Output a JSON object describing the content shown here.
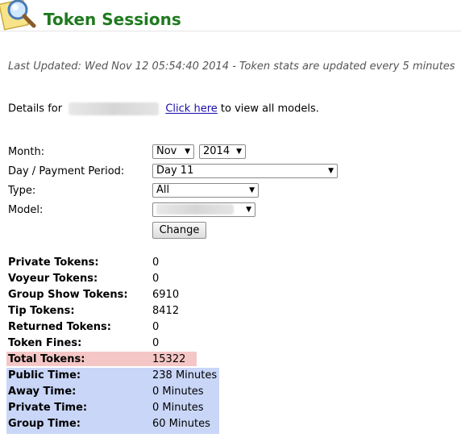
{
  "header": {
    "title": "Token Sessions"
  },
  "last_updated": "Last Updated: Wed Nov 12 05:54:40 2014 - Token stats are updated every 5 minutes",
  "details": {
    "prefix": "Details for",
    "link_text": "Click here",
    "suffix": "to view all models."
  },
  "form": {
    "month_label": "Month:",
    "month_value": "Nov",
    "year_value": "2014",
    "day_label": "Day / Payment Period:",
    "day_value": "Day 11",
    "type_label": "Type:",
    "type_value": "All",
    "model_label": "Model:",
    "change_button": "Change"
  },
  "stats": [
    {
      "label": "Private Tokens:",
      "value": "0"
    },
    {
      "label": "Voyeur Tokens:",
      "value": "0"
    },
    {
      "label": "Group Show Tokens:",
      "value": "6910"
    },
    {
      "label": "Tip Tokens:",
      "value": "8412"
    },
    {
      "label": "Returned Tokens:",
      "value": "0"
    },
    {
      "label": "Token Fines:",
      "value": "0"
    },
    {
      "label": "Total Tokens:",
      "value": "15322"
    },
    {
      "label": "Public Time:",
      "value": "238 Minutes"
    },
    {
      "label": "Away Time:",
      "value": "0 Minutes"
    },
    {
      "label": "Private Time:",
      "value": "0 Minutes"
    },
    {
      "label": "Group Time:",
      "value": "60 Minutes"
    }
  ],
  "colors": {
    "title": "#1f7a1f",
    "total_highlight": "#f5c6c6",
    "time_highlight": "#c9d6f8",
    "link": "#1a0dab"
  },
  "icons": {
    "logo": "magnifier-on-note-icon"
  }
}
